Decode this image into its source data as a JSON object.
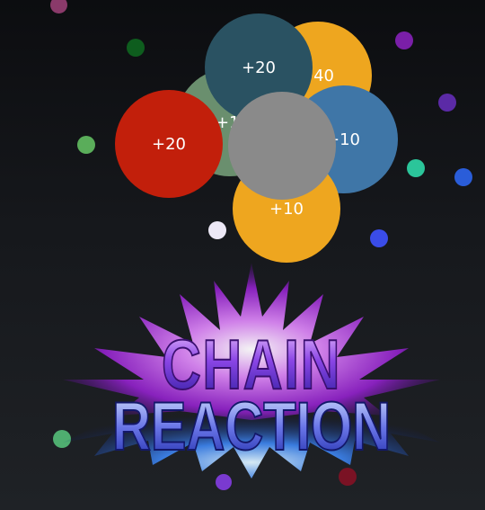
{
  "game": {
    "logo": {
      "line1": "CHAIN",
      "line2": "REACTION"
    },
    "balls": [
      {
        "label": "+10",
        "color": "#6a8f6e"
      },
      {
        "label": "+40",
        "color": "#eea61f"
      },
      {
        "label": "+10",
        "color": "#3f76a7"
      },
      {
        "label": "+20",
        "color": "#2a5262"
      },
      {
        "label": "+20",
        "color": "#c21f0b"
      },
      {
        "label": "+10",
        "color": "#eea61f"
      },
      {
        "label": "",
        "color": "#8a8a8a"
      }
    ],
    "particles": [
      {
        "color": "#8a3a6a"
      },
      {
        "color": "#0e5d1e"
      },
      {
        "color": "#7a1fa8"
      },
      {
        "color": "#5b2aa6"
      },
      {
        "color": "#5aad5a"
      },
      {
        "color": "#2bc59a"
      },
      {
        "color": "#2a5dd9"
      },
      {
        "color": "#ece8f6"
      },
      {
        "color": "#3a4ce8"
      },
      {
        "color": "#4fae70"
      },
      {
        "color": "#7a1224"
      },
      {
        "color": "#7a3ad0"
      }
    ]
  }
}
